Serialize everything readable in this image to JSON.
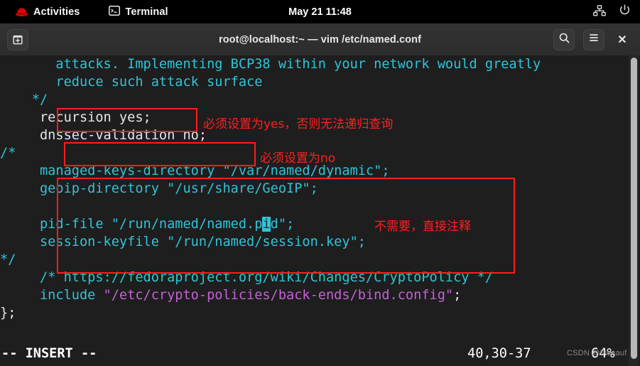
{
  "topbar": {
    "activities_label": "Activities",
    "activities_icon": "redhat-logo-icon",
    "app_label": "Terminal",
    "app_icon": "terminal-icon",
    "clock": "May 21  11:48",
    "network_icon": "network-icon",
    "power_icon": "power-icon"
  },
  "titlebar": {
    "new_tab_icon": "new-tab-icon",
    "title": "root@localhost:~ — vim /etc/named.conf",
    "search_icon": "search-icon",
    "menu_icon": "hamburger-menu-icon",
    "close_label": "✕"
  },
  "terminal": {
    "lines": [
      {
        "indent": 7,
        "segments": [
          {
            "t": "attacks. Implementing BCP38 within your network would greatly",
            "c": "cyan"
          }
        ]
      },
      {
        "indent": 7,
        "segments": [
          {
            "t": "reduce such attack surface",
            "c": "cyan"
          }
        ]
      },
      {
        "indent": 4,
        "segments": [
          {
            "t": "*/",
            "c": "cyan"
          }
        ]
      },
      {
        "indent": 5,
        "segments": [
          {
            "t": "recursion yes;",
            "c": "white"
          }
        ]
      },
      {
        "indent": 5,
        "segments": [
          {
            "t": "dnssec-validation no;",
            "c": "white"
          }
        ]
      },
      {
        "indent": 0,
        "segments": [
          {
            "t": "/*",
            "c": "cyan"
          }
        ]
      },
      {
        "indent": 5,
        "segments": [
          {
            "t": "managed-keys-directory \"/var/named/dynamic\";",
            "c": "cyan"
          }
        ]
      },
      {
        "indent": 5,
        "segments": [
          {
            "t": "geoip-directory \"/usr/share/GeoIP\";",
            "c": "cyan"
          }
        ]
      },
      {
        "indent": 0,
        "segments": [
          {
            "t": "",
            "c": "cyan"
          }
        ]
      },
      {
        "indent": 5,
        "segments": [
          {
            "t": "pid-file \"/run/named/named.p",
            "c": "cyan"
          },
          {
            "t": "i",
            "c": "cursor"
          },
          {
            "t": "d\";",
            "c": "cyan"
          }
        ]
      },
      {
        "indent": 5,
        "segments": [
          {
            "t": "session-keyfile \"/run/named/session.key\";",
            "c": "cyan"
          }
        ]
      },
      {
        "indent": 0,
        "segments": [
          {
            "t": "*/",
            "c": "cyan"
          }
        ]
      },
      {
        "indent": 5,
        "segments": [
          {
            "t": "/* https://fedoraproject.org/wiki/Changes/CryptoPolicy */",
            "c": "cyan"
          }
        ]
      },
      {
        "indent": 5,
        "segments": [
          {
            "t": "include ",
            "c": "cyan"
          },
          {
            "t": "\"/etc/crypto-policies/back-ends/bind.config\"",
            "c": "magenta"
          },
          {
            "t": ";",
            "c": "white"
          }
        ]
      },
      {
        "indent": 0,
        "segments": [
          {
            "t": "};",
            "c": "white"
          }
        ]
      }
    ],
    "status_mode": "-- INSERT --",
    "status_position": "40,30-37",
    "status_percent": "64%",
    "watermark": "CSDN @Meaauf"
  },
  "annotations": {
    "note_recursion": "必须设置为yes，否则无法递归查询",
    "note_dnssec": "必须设置为no",
    "note_comment_block": "不需要，直接注释",
    "box_color": "#ff1c1c"
  }
}
